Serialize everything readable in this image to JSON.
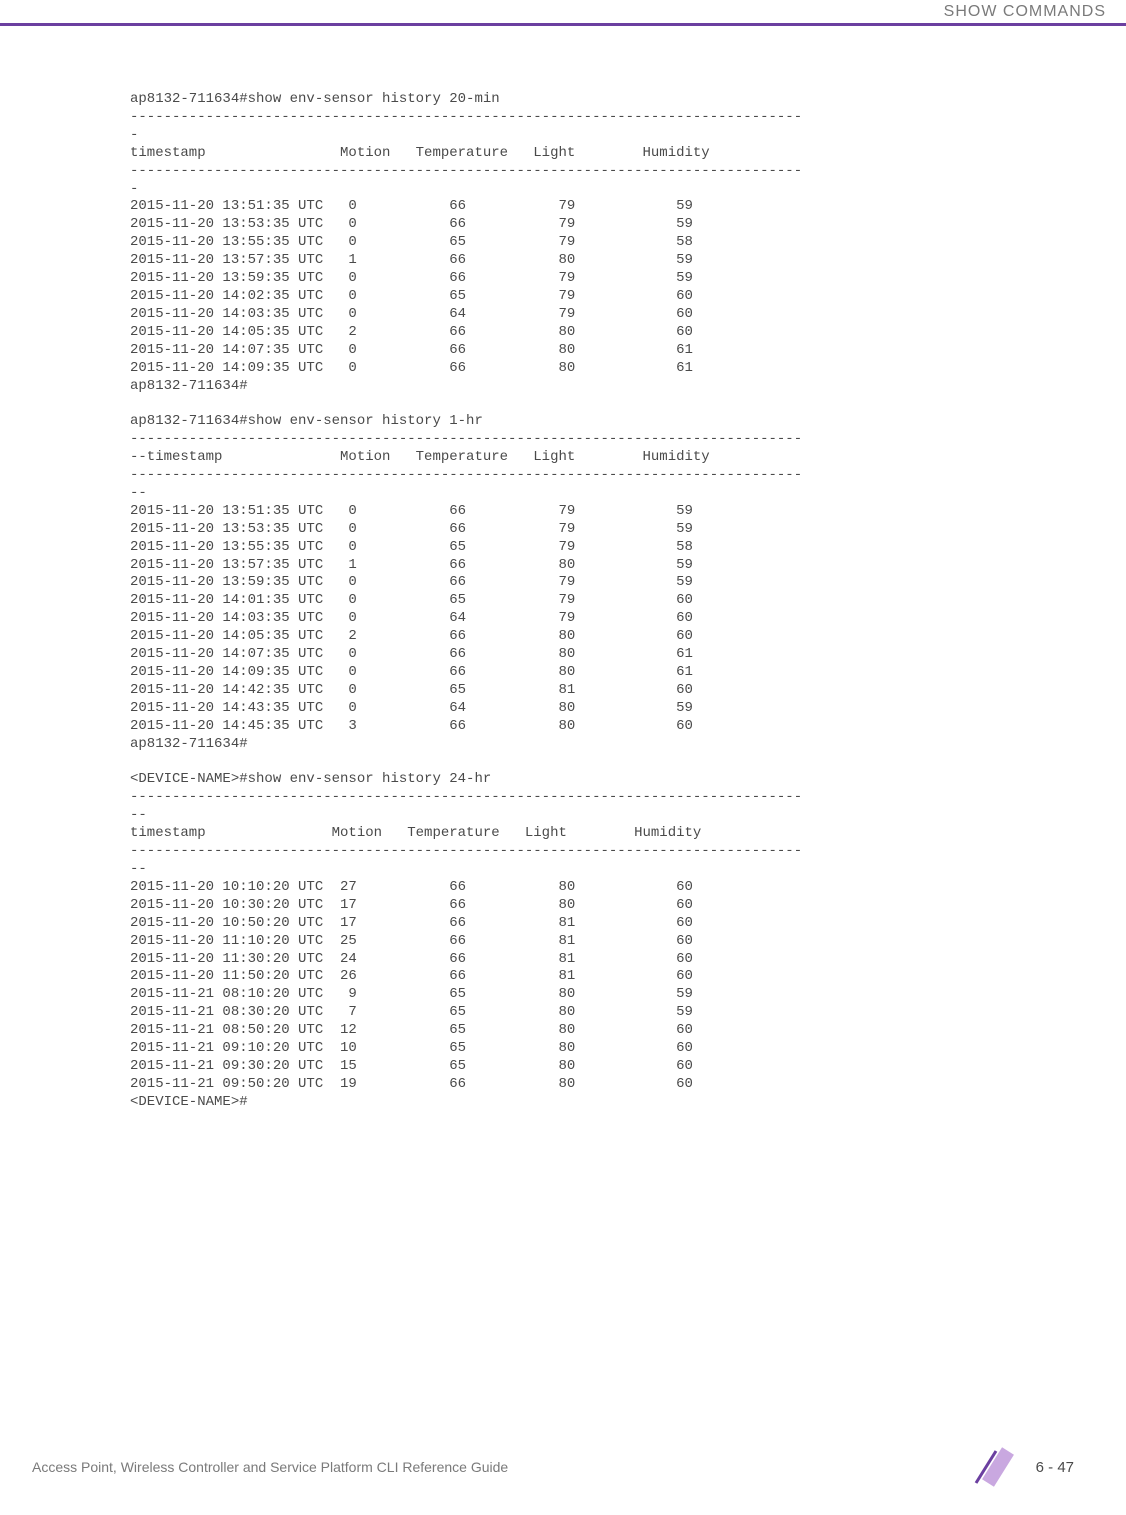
{
  "header": {
    "title": "SHOW COMMANDS"
  },
  "cli": {
    "cmd1": "ap8132-711634#show env-sensor history 20-min",
    "sep1": "--------------------------------------------------------------------------------",
    "dash_fragment1": "-",
    "header1": "timestamp                Motion   Temperature   Light        Humidity",
    "sep2": "--------------------------------------------------------------------------------",
    "dash_fragment2": "-",
    "t1_rows": [
      "2015-11-20 13:51:35 UTC   0           66           79            59",
      "2015-11-20 13:53:35 UTC   0           66           79            59",
      "2015-11-20 13:55:35 UTC   0           65           79            58",
      "2015-11-20 13:57:35 UTC   1           66           80            59",
      "2015-11-20 13:59:35 UTC   0           66           79            59",
      "2015-11-20 14:02:35 UTC   0           65           79            60",
      "2015-11-20 14:03:35 UTC   0           64           79            60",
      "2015-11-20 14:05:35 UTC   2           66           80            60",
      "2015-11-20 14:07:35 UTC   0           66           80            61",
      "2015-11-20 14:09:35 UTC   0           66           80            61"
    ],
    "prompt1": "ap8132-711634#",
    "blank": "",
    "cmd2": "ap8132-711634#show env-sensor history 1-hr",
    "sep3": "--------------------------------------------------------------------------------",
    "header2": "--timestamp              Motion   Temperature   Light        Humidity",
    "sep4": "--------------------------------------------------------------------------------",
    "dash_fragment3": "--",
    "t2_rows": [
      "2015-11-20 13:51:35 UTC   0           66           79            59",
      "2015-11-20 13:53:35 UTC   0           66           79            59",
      "2015-11-20 13:55:35 UTC   0           65           79            58",
      "2015-11-20 13:57:35 UTC   1           66           80            59",
      "2015-11-20 13:59:35 UTC   0           66           79            59",
      "2015-11-20 14:01:35 UTC   0           65           79            60",
      "2015-11-20 14:03:35 UTC   0           64           79            60",
      "2015-11-20 14:05:35 UTC   2           66           80            60",
      "2015-11-20 14:07:35 UTC   0           66           80            61",
      "2015-11-20 14:09:35 UTC   0           66           80            61",
      "2015-11-20 14:42:35 UTC   0           65           81            60",
      "2015-11-20 14:43:35 UTC   0           64           80            59",
      "2015-11-20 14:45:35 UTC   3           66           80            60"
    ],
    "prompt2": "ap8132-711634#",
    "cmd3": "<DEVICE-NAME>#show env-sensor history 24-hr",
    "sep5": "--------------------------------------------------------------------------------",
    "dash_fragment4": "--",
    "header3": "timestamp               Motion   Temperature   Light        Humidity",
    "sep6": "--------------------------------------------------------------------------------",
    "dash_fragment5": "--",
    "t3_rows": [
      "2015-11-20 10:10:20 UTC  27           66           80            60",
      "2015-11-20 10:30:20 UTC  17           66           80            60",
      "2015-11-20 10:50:20 UTC  17           66           81            60",
      "2015-11-20 11:10:20 UTC  25           66           81            60",
      "2015-11-20 11:30:20 UTC  24           66           81            60",
      "2015-11-20 11:50:20 UTC  26           66           81            60",
      "2015-11-21 08:10:20 UTC   9           65           80            59",
      "2015-11-21 08:30:20 UTC   7           65           80            59",
      "2015-11-21 08:50:20 UTC  12           65           80            60",
      "2015-11-21 09:10:20 UTC  10           65           80            60",
      "2015-11-21 09:30:20 UTC  15           65           80            60",
      "2015-11-21 09:50:20 UTC  19           66           80            60"
    ],
    "prompt3": "<DEVICE-NAME>#"
  },
  "footer": {
    "text": "Access Point, Wireless Controller and Service Platform CLI Reference Guide",
    "page": "6 - 47"
  },
  "chart_data": [
    {
      "type": "table",
      "title": "env-sensor history 20-min",
      "columns": [
        "timestamp",
        "Motion",
        "Temperature",
        "Light",
        "Humidity"
      ],
      "rows": [
        [
          "2015-11-20 13:51:35 UTC",
          0,
          66,
          79,
          59
        ],
        [
          "2015-11-20 13:53:35 UTC",
          0,
          66,
          79,
          59
        ],
        [
          "2015-11-20 13:55:35 UTC",
          0,
          65,
          79,
          58
        ],
        [
          "2015-11-20 13:57:35 UTC",
          1,
          66,
          80,
          59
        ],
        [
          "2015-11-20 13:59:35 UTC",
          0,
          66,
          79,
          59
        ],
        [
          "2015-11-20 14:02:35 UTC",
          0,
          65,
          79,
          60
        ],
        [
          "2015-11-20 14:03:35 UTC",
          0,
          64,
          79,
          60
        ],
        [
          "2015-11-20 14:05:35 UTC",
          2,
          66,
          80,
          60
        ],
        [
          "2015-11-20 14:07:35 UTC",
          0,
          66,
          80,
          61
        ],
        [
          "2015-11-20 14:09:35 UTC",
          0,
          66,
          80,
          61
        ]
      ]
    },
    {
      "type": "table",
      "title": "env-sensor history 1-hr",
      "columns": [
        "timestamp",
        "Motion",
        "Temperature",
        "Light",
        "Humidity"
      ],
      "rows": [
        [
          "2015-11-20 13:51:35 UTC",
          0,
          66,
          79,
          59
        ],
        [
          "2015-11-20 13:53:35 UTC",
          0,
          66,
          79,
          59
        ],
        [
          "2015-11-20 13:55:35 UTC",
          0,
          65,
          79,
          58
        ],
        [
          "2015-11-20 13:57:35 UTC",
          1,
          66,
          80,
          59
        ],
        [
          "2015-11-20 13:59:35 UTC",
          0,
          66,
          79,
          59
        ],
        [
          "2015-11-20 14:01:35 UTC",
          0,
          65,
          79,
          60
        ],
        [
          "2015-11-20 14:03:35 UTC",
          0,
          64,
          79,
          60
        ],
        [
          "2015-11-20 14:05:35 UTC",
          2,
          66,
          80,
          60
        ],
        [
          "2015-11-20 14:07:35 UTC",
          0,
          66,
          80,
          61
        ],
        [
          "2015-11-20 14:09:35 UTC",
          0,
          66,
          80,
          61
        ],
        [
          "2015-11-20 14:42:35 UTC",
          0,
          65,
          81,
          60
        ],
        [
          "2015-11-20 14:43:35 UTC",
          0,
          64,
          80,
          59
        ],
        [
          "2015-11-20 14:45:35 UTC",
          3,
          66,
          80,
          60
        ]
      ]
    },
    {
      "type": "table",
      "title": "env-sensor history 24-hr",
      "columns": [
        "timestamp",
        "Motion",
        "Temperature",
        "Light",
        "Humidity"
      ],
      "rows": [
        [
          "2015-11-20 10:10:20 UTC",
          27,
          66,
          80,
          60
        ],
        [
          "2015-11-20 10:30:20 UTC",
          17,
          66,
          80,
          60
        ],
        [
          "2015-11-20 10:50:20 UTC",
          17,
          66,
          81,
          60
        ],
        [
          "2015-11-20 11:10:20 UTC",
          25,
          66,
          81,
          60
        ],
        [
          "2015-11-20 11:30:20 UTC",
          24,
          66,
          81,
          60
        ],
        [
          "2015-11-20 11:50:20 UTC",
          26,
          66,
          81,
          60
        ],
        [
          "2015-11-21 08:10:20 UTC",
          9,
          65,
          80,
          59
        ],
        [
          "2015-11-21 08:30:20 UTC",
          7,
          65,
          80,
          59
        ],
        [
          "2015-11-21 08:50:20 UTC",
          12,
          65,
          80,
          60
        ],
        [
          "2015-11-21 09:10:20 UTC",
          10,
          65,
          80,
          60
        ],
        [
          "2015-11-21 09:30:20 UTC",
          15,
          65,
          80,
          60
        ],
        [
          "2015-11-21 09:50:20 UTC",
          19,
          66,
          80,
          60
        ]
      ]
    }
  ]
}
